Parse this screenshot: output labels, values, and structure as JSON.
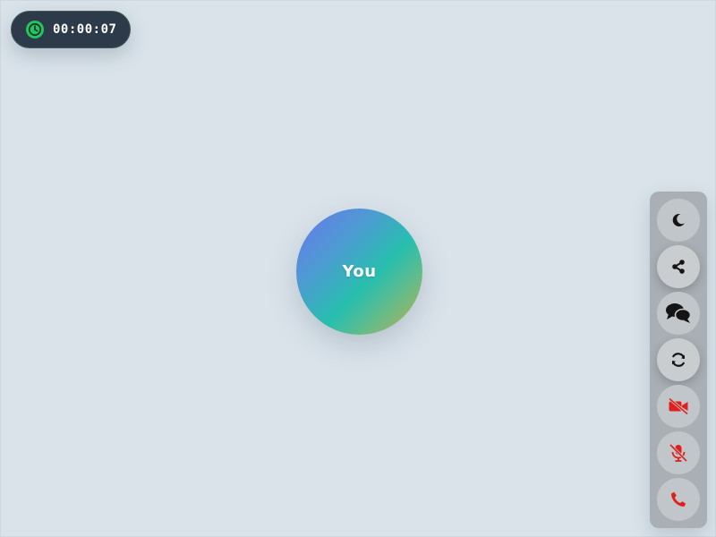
{
  "timer": {
    "elapsed": "00:00:07",
    "icon": "clock-icon",
    "icon_color": "#22c55e"
  },
  "participant": {
    "label": "You"
  },
  "controls": {
    "items": [
      {
        "name": "theme-toggle",
        "icon": "moon-icon"
      },
      {
        "name": "share",
        "icon": "share-icon"
      },
      {
        "name": "chat",
        "icon": "chat-bubbles-icon"
      },
      {
        "name": "switch-camera",
        "icon": "refresh-icon"
      },
      {
        "name": "video-off",
        "icon": "video-off-icon",
        "color": "#e0201a"
      },
      {
        "name": "mic-off",
        "icon": "mic-off-icon",
        "color": "#e0201a"
      },
      {
        "name": "end-call",
        "icon": "phone-icon",
        "color": "#e0201a"
      }
    ]
  }
}
